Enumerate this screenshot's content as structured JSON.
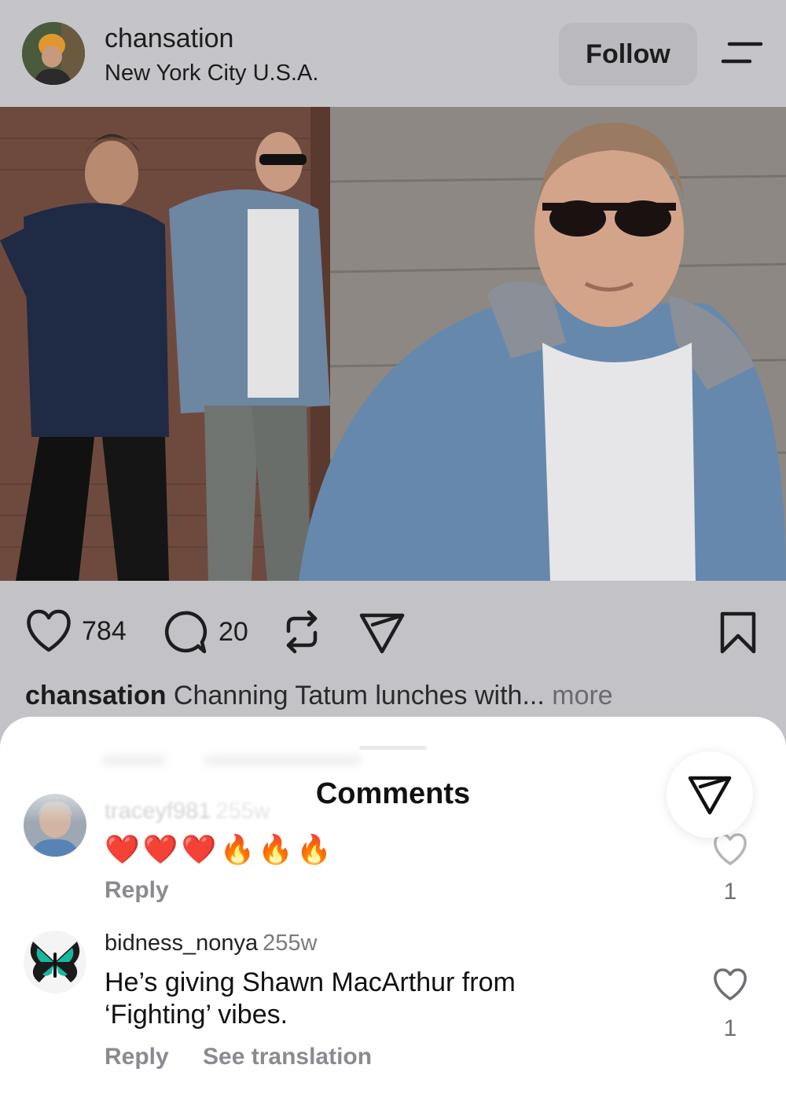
{
  "header": {
    "username": "chansation",
    "location": "New York City U.S.A.",
    "follow_label": "Follow"
  },
  "post": {
    "likes": "784",
    "comments": "20",
    "caption_user": "chansation",
    "caption_text": " Channing Tatum lunches with...",
    "more_label": " more"
  },
  "comments_sheet": {
    "title": "Comments",
    "comments": [
      {
        "username": "traceyf981",
        "ago": "255w",
        "text": "❤️❤️❤️🔥🔥🔥",
        "reply_label": "Reply",
        "likes": "1"
      },
      {
        "username": "bidness_nonya",
        "ago": "255w",
        "text": "He’s giving Shawn MacArthur from ‘Fighting’ vibes.",
        "reply_label": "Reply",
        "translation_label": "See translation",
        "likes": "1"
      }
    ]
  },
  "icons": {
    "menu": "menu-icon",
    "like": "heart-icon",
    "comment": "comment-bubble-icon",
    "repost": "repost-icon",
    "share": "send-icon",
    "save": "bookmark-icon"
  },
  "colors": {
    "overlay_background": "#c3c3c7",
    "sheet_background": "#ffffff",
    "secondary_text": "#8a8a90"
  }
}
